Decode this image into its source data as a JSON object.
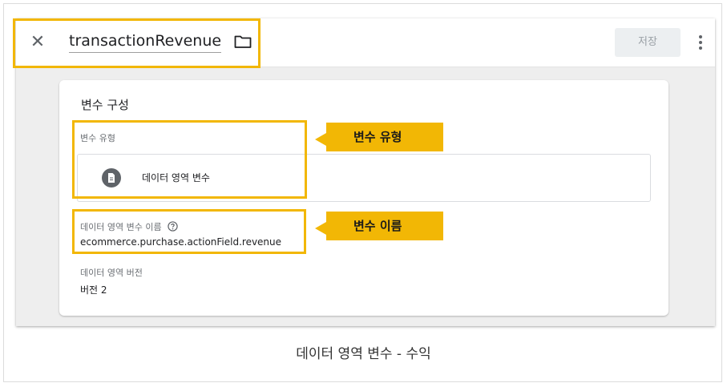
{
  "header": {
    "close_symbol": "✕",
    "title": "transactionRevenue",
    "save_label": "저장"
  },
  "card": {
    "section_title": "변수 구성",
    "variable_type_label": "변수 유형",
    "variable_type_value": "데이터 영역 변수",
    "dl_variable_name_label": "데이터 영역 변수 이름",
    "dl_variable_name_value": "ecommerce.purchase.actionField.revenue",
    "dl_version_label": "데이터 영역 버전",
    "dl_version_value": "버전 2"
  },
  "annotations": {
    "callout_type": "변수 유형",
    "callout_name": "변수 이름",
    "highlight_color": "#f2b705"
  },
  "icons": [
    "close-icon",
    "folder-icon",
    "more-vert-icon",
    "document-icon",
    "help-icon"
  ],
  "caption": "데이터 영역 변수 - 수익"
}
